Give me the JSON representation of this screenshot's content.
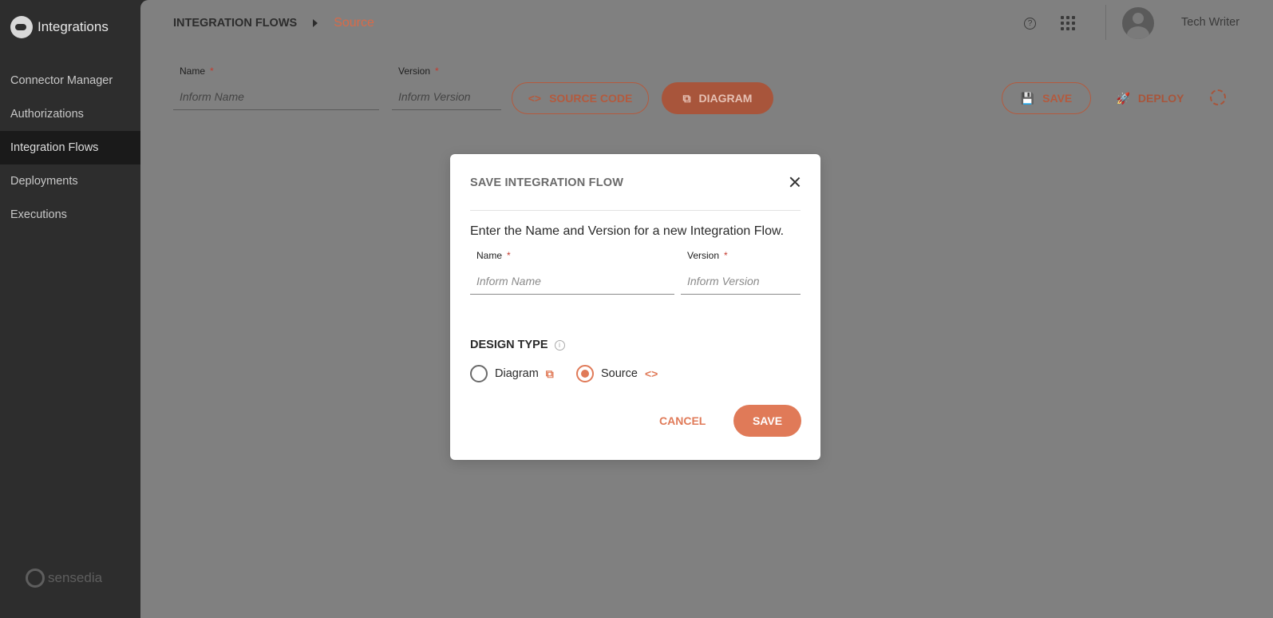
{
  "app": {
    "title": "Integrations",
    "brand": "sensedia"
  },
  "sidebar": {
    "items": [
      {
        "label": "Connector Manager",
        "active": false
      },
      {
        "label": "Authorizations",
        "active": false
      },
      {
        "label": "Integration Flows",
        "active": true
      },
      {
        "label": "Deployments",
        "active": false
      },
      {
        "label": "Executions",
        "active": false
      }
    ]
  },
  "header": {
    "breadcrumb_root": "INTEGRATION FLOWS",
    "breadcrumb_current": "Source",
    "username": "Tech Writer",
    "help_icon": "?"
  },
  "form": {
    "name_label": "Name",
    "name_placeholder": "Inform Name",
    "version_label": "Version",
    "version_placeholder": "Inform Version",
    "required_mark": "*"
  },
  "toolbar": {
    "source_code_label": "SOURCE CODE",
    "source_code_icon": "<>",
    "diagram_label": "DIAGRAM",
    "diagram_icon": "⧉",
    "save_label": "SAVE",
    "save_icon": "💾",
    "deploy_label": "DEPLOY",
    "deploy_icon": "🚀"
  },
  "modal": {
    "title": "SAVE INTEGRATION FLOW",
    "description": "Enter the Name and Version for a new Integration Flow.",
    "name_label": "Name",
    "name_placeholder": "Inform Name",
    "version_label": "Version",
    "version_placeholder": "Inform Version",
    "required_mark": "*",
    "design_type_label": "DESIGN TYPE",
    "info_icon": "i",
    "options": [
      {
        "label": "Diagram",
        "icon": "⧉",
        "checked": false
      },
      {
        "label": "Source",
        "icon": "<>",
        "checked": true
      }
    ],
    "cancel_label": "CANCEL",
    "save_label": "SAVE"
  },
  "colors": {
    "accent": "#e07a58",
    "accent_dim": "#a8553b",
    "overlay": "#808080",
    "sidebar": "#2d2d2d"
  }
}
